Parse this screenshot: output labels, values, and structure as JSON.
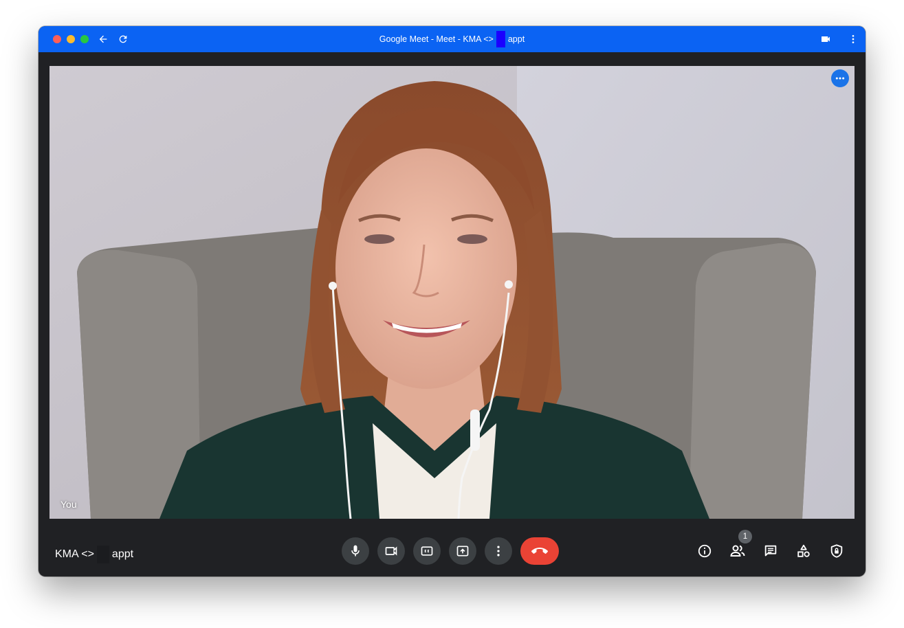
{
  "window": {
    "title_prefix": "Google Meet - Meet - KMA <>",
    "title_suffix": "appt"
  },
  "video": {
    "self_label": "You"
  },
  "meeting": {
    "name_prefix": "KMA <>",
    "name_suffix": "appt"
  },
  "controls": [
    "microphone",
    "camera",
    "captions",
    "present-screen",
    "more-options",
    "end-call"
  ],
  "right_controls": [
    "meeting-details",
    "people",
    "chat",
    "activities",
    "host-controls"
  ],
  "people_count": "1",
  "colors": {
    "titlebar": "#0b63f3",
    "background": "#202124",
    "control_button": "#3c4043",
    "end_call": "#ea4335",
    "accent": "#1a73e8"
  }
}
